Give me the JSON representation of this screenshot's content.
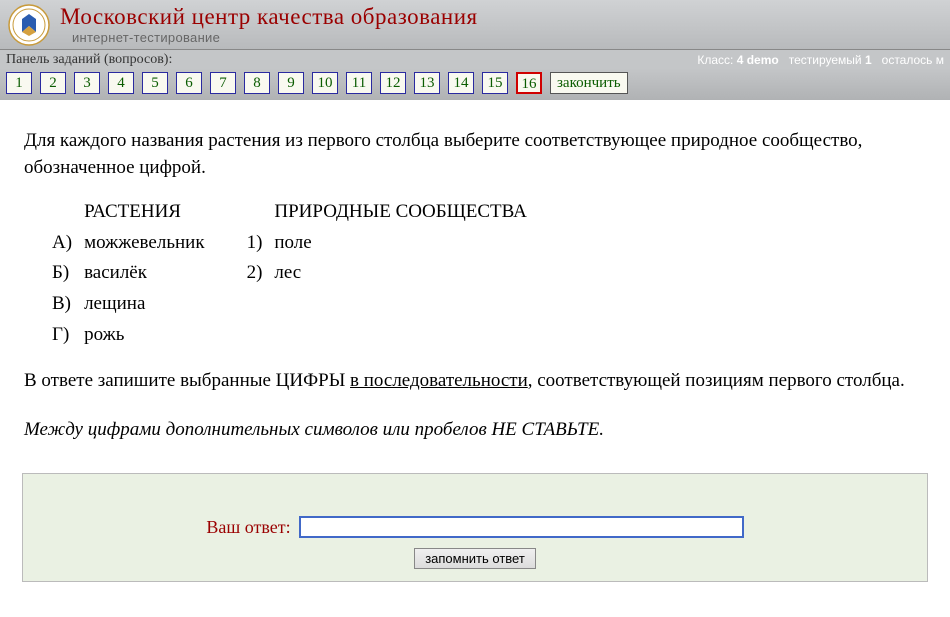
{
  "header": {
    "title": "Московский центр качества образования",
    "subtitle": "интернет-тестирование"
  },
  "panel": {
    "label": "Панель заданий (вопросов):",
    "questions": [
      "1",
      "2",
      "3",
      "4",
      "5",
      "6",
      "7",
      "8",
      "9",
      "10",
      "11",
      "12",
      "13",
      "14",
      "15",
      "16"
    ],
    "active_index": 15,
    "finish": "закончить",
    "info": {
      "class_label": "Класс:",
      "class_value": "4 demo",
      "user_label": "тестируемый",
      "user_value": "1",
      "remain_label": "осталось м"
    }
  },
  "question": {
    "intro": "Для каждого названия растения из первого столбца выберите соответствующее природное сообщество, обозначенное цифрой.",
    "left_header": "РАСТЕНИЯ",
    "right_header": "ПРИРОДНЫЕ СООБЩЕСТВА",
    "left_items": [
      {
        "mark": "А)",
        "text": "можжевельник"
      },
      {
        "mark": "Б)",
        "text": "василёк"
      },
      {
        "mark": "В)",
        "text": "лещина"
      },
      {
        "mark": "Г)",
        "text": "рожь"
      }
    ],
    "right_items": [
      {
        "mark": "1)",
        "text": "поле"
      },
      {
        "mark": "2)",
        "text": "лес"
      }
    ],
    "instr_prefix": "В ответе запишите выбранные ЦИФРЫ ",
    "instr_underlined": "в последовательности",
    "instr_suffix": ", соответствующей позициям первого столбца.",
    "note": "Между цифрами дополнительных символов или пробелов НЕ СТАВЬТЕ."
  },
  "answer": {
    "label": "Ваш ответ:",
    "value": "",
    "save": "запомнить ответ"
  }
}
